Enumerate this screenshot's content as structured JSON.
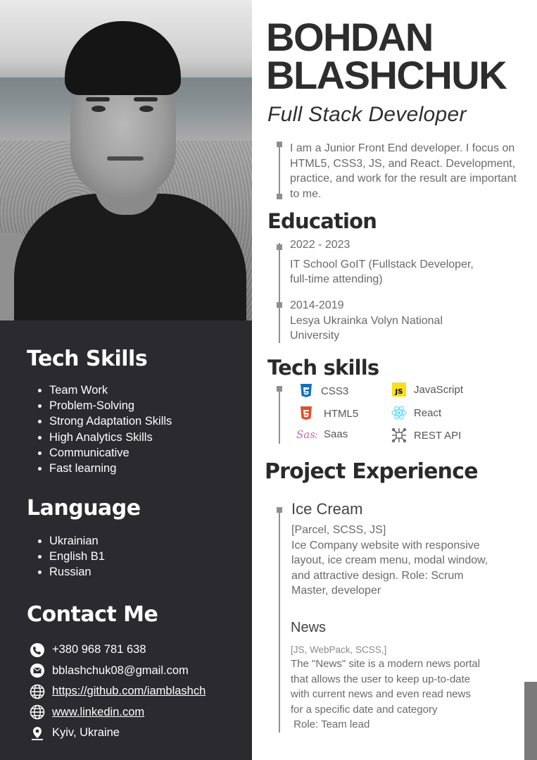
{
  "name": {
    "first": "BOHDAN",
    "last": "BLASHCHUK"
  },
  "role": "Full Stack Developer",
  "about": "I am a Junior Front End developer. I focus on HTML5, CSS3, JS, and React. Development, practice, and work for the result are important to me.",
  "tech_skills_left": {
    "title": "Tech Skills",
    "items": [
      "Team Work",
      "Problem-Solving",
      "Strong Adaptation Skills",
      "High Analytics Skills",
      "Communicative",
      "Fast learning"
    ]
  },
  "language": {
    "title": "Language",
    "items": [
      "Ukrainian",
      "English B1",
      "Russian"
    ]
  },
  "contact": {
    "title": "Contact Me",
    "phone": "+380 968 781 638",
    "email": "bblashchuk08@gmail.com",
    "github": "https://github.com/iamblashch",
    "linkedin": "www.linkedin.com",
    "location": "Kyiv, Ukraine"
  },
  "education": {
    "title": "Education",
    "entries": [
      {
        "years": "2022 - 2023",
        "lines": [
          "IT School GoIT (Fullstack Developer,",
          "full-time attending)"
        ]
      },
      {
        "years": "2014-2019",
        "lines": [
          "Lesya Ukrainka Volyn National",
          "University"
        ]
      }
    ]
  },
  "tech_skills_right": {
    "title": "Tech skills",
    "items": [
      {
        "label": "CSS3",
        "icon": "css3-icon"
      },
      {
        "label": "JavaScript",
        "icon": "javascript-icon"
      },
      {
        "label": "HTML5",
        "icon": "html5-icon"
      },
      {
        "label": "React",
        "icon": "react-icon"
      },
      {
        "label": "Saas",
        "icon": "sass-icon"
      },
      {
        "label": "REST API",
        "icon": "rest-api-icon"
      }
    ]
  },
  "projects": {
    "title": "Project Experience",
    "entries": [
      {
        "name": "Ice Cream",
        "stack": "[Parcel, SCSS, JS]",
        "lines": [
          "Ice Company website with responsive",
          "layout, ice cream menu, modal window,",
          "and attractive design. Role: Scrum",
          "Master, developer"
        ]
      },
      {
        "name": "News",
        "stack": "[JS,  WebPack,  SCSS,]",
        "lines": [
          "The \"News\" site is a modern news portal",
          "that allows the user to keep up-to-date",
          "with current news and even read news",
          "for a specific date and category",
          " Role: Team lead"
        ]
      }
    ]
  },
  "colors": {
    "sidebar": "#2a2a2f",
    "text_dark": "#2d2d2d",
    "text_muted": "#6a6a6a",
    "timeline": "#8f8f8f"
  }
}
